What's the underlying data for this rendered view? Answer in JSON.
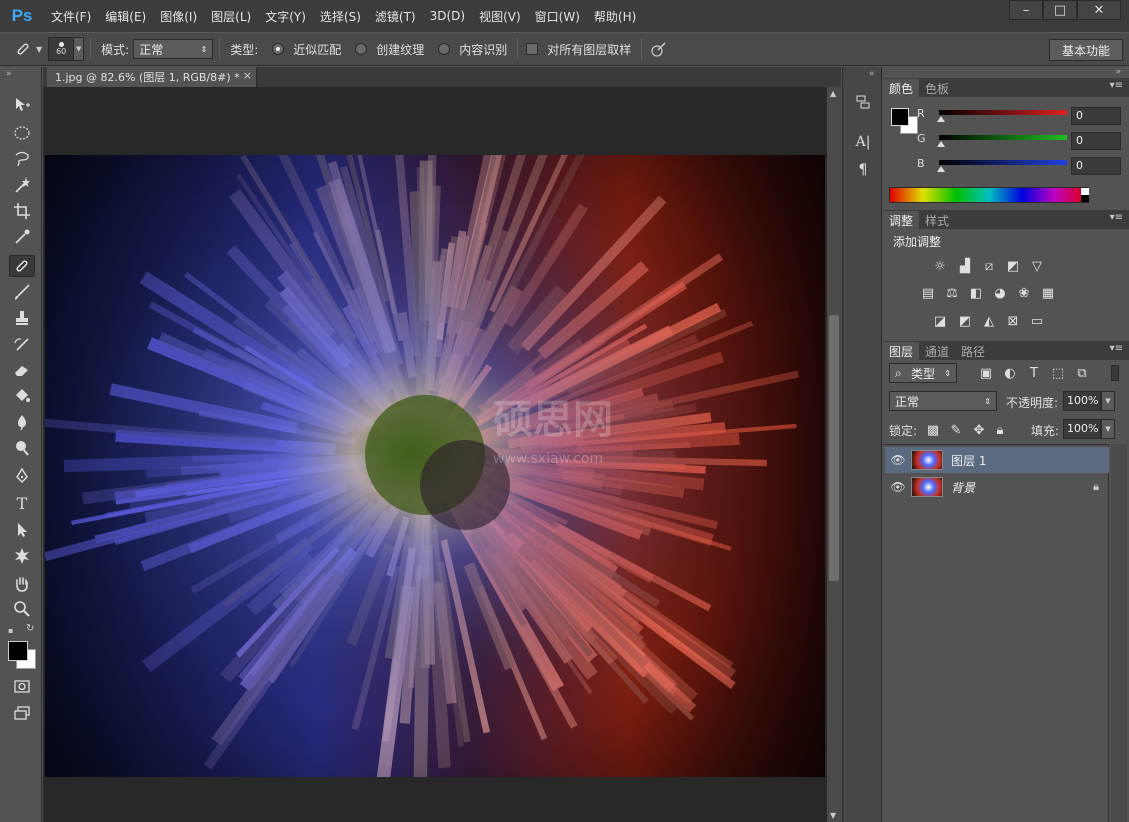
{
  "app": {
    "logo": "Ps"
  },
  "menu": [
    "文件(F)",
    "编辑(E)",
    "图像(I)",
    "图层(L)",
    "文字(Y)",
    "选择(S)",
    "滤镜(T)",
    "3D(D)",
    "视图(V)",
    "窗口(W)",
    "帮助(H)"
  ],
  "window_controls": {
    "minimize": "–",
    "maximize": "□",
    "close": "✕"
  },
  "options": {
    "brush_size": "60",
    "mode_label": "模式:",
    "mode_value": "正常",
    "type_label": "类型:",
    "type_options": [
      "近似匹配",
      "创建纹理",
      "内容识别"
    ],
    "type_selected": "近似匹配",
    "sample_all_layers": "对所有图层取样",
    "workspace": "基本功能"
  },
  "document": {
    "tab_title": "1.jpg @ 82.6% (图层 1, RGB/8#) *",
    "close": "×"
  },
  "color_panel": {
    "tabs": [
      "颜色",
      "色板"
    ],
    "channels": [
      {
        "label": "R",
        "value": "0",
        "color": "#e02020"
      },
      {
        "label": "G",
        "value": "0",
        "color": "#20c020"
      },
      {
        "label": "B",
        "value": "0",
        "color": "#2040e0"
      }
    ],
    "foreground": "#000000",
    "background": "#ffffff"
  },
  "adjust_panel": {
    "tabs": [
      "调整",
      "样式"
    ],
    "title": "添加调整"
  },
  "layers_panel": {
    "tabs": [
      "图层",
      "通道",
      "路径"
    ],
    "filter_label": "类型",
    "blend_mode": "正常",
    "opacity_label": "不透明度:",
    "opacity_value": "100%",
    "lock_label": "锁定:",
    "fill_label": "填充:",
    "fill_value": "100%",
    "layers": [
      {
        "name": "图层 1",
        "selected": true,
        "locked": false
      },
      {
        "name": "背景",
        "selected": false,
        "locked": true
      }
    ]
  },
  "canvas": {
    "watermark_main": "硕思网",
    "watermark_url": "www.sxiaw.com"
  },
  "colors": {
    "accent": "#3fa9f5",
    "selected_layer": "#5a6a80"
  }
}
